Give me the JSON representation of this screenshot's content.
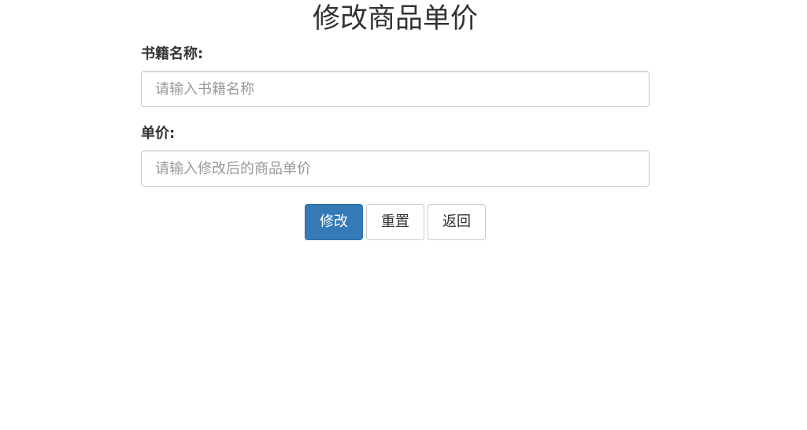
{
  "page": {
    "title": "修改商品单价"
  },
  "form": {
    "book_name": {
      "label": "书籍名称:",
      "value": "",
      "placeholder": "请输入书籍名称"
    },
    "price": {
      "label": "单价:",
      "value": "",
      "placeholder": "请输入修改后的商品单价"
    }
  },
  "buttons": {
    "submit_label": "修改",
    "reset_label": "重置",
    "back_label": "返回"
  },
  "colors": {
    "primary": "#337ab7",
    "primary_border": "#2e6da4",
    "text": "#333333",
    "input_border": "#cccccc",
    "placeholder": "#999999"
  }
}
